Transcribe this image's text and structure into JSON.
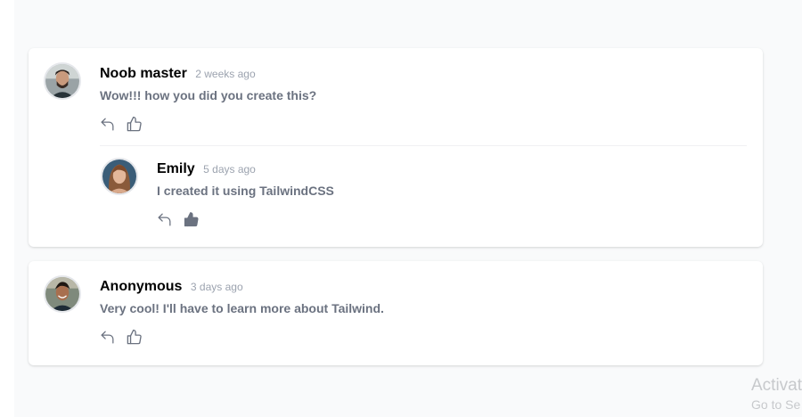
{
  "comments": [
    {
      "name": "Noob master",
      "time": "2 weeks ago",
      "text": "Wow!!! how you did you create this?",
      "liked": false,
      "replies": [
        {
          "name": "Emily",
          "time": "5 days ago",
          "text": "I created it using TailwindCSS",
          "liked": true
        }
      ]
    },
    {
      "name": "Anonymous",
      "time": "3 days ago",
      "text": "Very cool! I'll have to learn more about Tailwind.",
      "liked": false,
      "replies": []
    }
  ],
  "icons": {
    "reply": "reply-icon",
    "like": "thumbs-up-icon"
  },
  "colors": {
    "name": "#000000",
    "time": "#9ca3af",
    "text": "#6b7280",
    "icon": "#6b7280"
  },
  "watermark": {
    "line1": "Activat",
    "line2": "Go to Se"
  }
}
